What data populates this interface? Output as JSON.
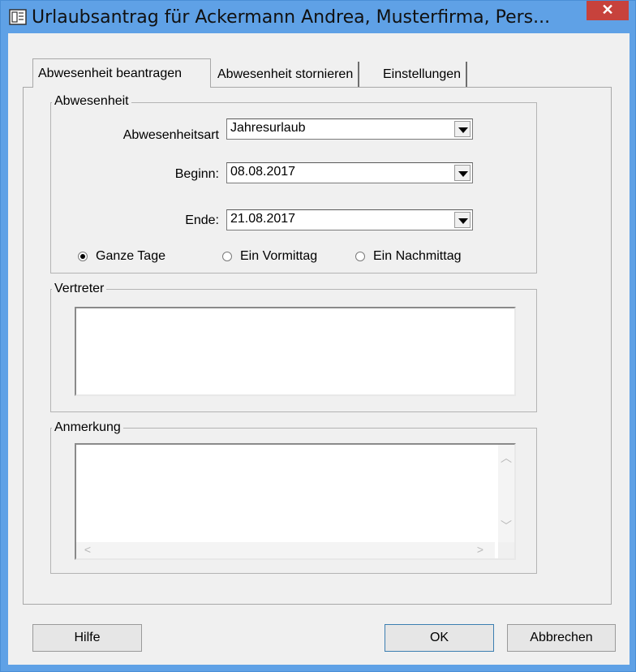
{
  "window": {
    "title": "Urlaubsantrag für  Ackermann Andrea, Musterfirma, Pers...",
    "close_label": "✕"
  },
  "tabs": [
    {
      "label": "Abwesenheit beantragen",
      "active": true
    },
    {
      "label": "Abwesenheit stornieren",
      "active": false
    },
    {
      "label": "Einstellungen",
      "active": false
    }
  ],
  "abwesenheit": {
    "group_label": "Abwesenheit",
    "art_label": "Abwesenheitsart",
    "art_value": "Jahresurlaub",
    "beginn_label": "Beginn:",
    "beginn_value": "08.08.2017",
    "ende_label": "Ende:",
    "ende_value": "21.08.2017",
    "radios": [
      {
        "label": "Ganze Tage",
        "selected": true
      },
      {
        "label": "Ein Vormittag",
        "selected": false
      },
      {
        "label": "Ein Nachmittag",
        "selected": false
      }
    ]
  },
  "vertreter": {
    "group_label": "Vertreter",
    "value": ""
  },
  "anmerkung": {
    "group_label": "Anmerkung",
    "value": ""
  },
  "buttons": {
    "help": "Hilfe",
    "ok": "OK",
    "cancel": "Abbrechen"
  },
  "colors": {
    "titlebar": "#5fa1e6",
    "close": "#c7423c",
    "dialog_bg": "#f0f0f0"
  },
  "icons": {
    "app": "form-document-icon",
    "close": "close-icon",
    "combo_arrow": "chevron-down-icon",
    "scroll_up": "chevron-up-icon",
    "scroll_down": "chevron-down-icon",
    "scroll_left": "chevron-left-icon",
    "scroll_right": "chevron-right-icon"
  }
}
